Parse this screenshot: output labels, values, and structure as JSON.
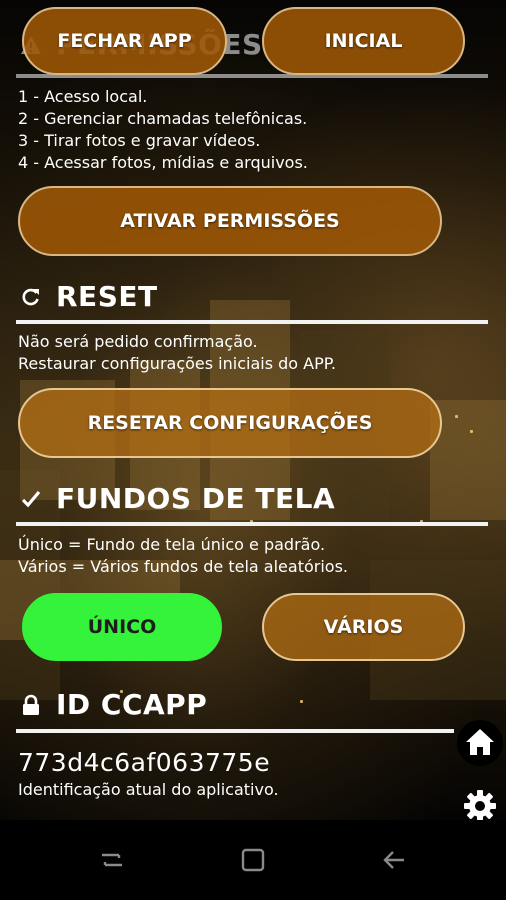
{
  "top_buttons": {
    "close_label": "FECHAR APP",
    "home_label": "INICIAL"
  },
  "permissions": {
    "title": "PERMISSÕES",
    "items": [
      "1 - Acesso local.",
      "2 - Gerenciar chamadas telefônicas.",
      "3 - Tirar fotos e gravar vídeos.",
      "4 - Acessar fotos, mídias e arquivos."
    ],
    "button_label": "ATIVAR PERMISSÕES"
  },
  "reset": {
    "title": "RESET",
    "lines": [
      "Não será pedido confirmação.",
      "Restaurar configurações iniciais do APP."
    ],
    "button_label": "RESETAR CONFIGURAÇÕES"
  },
  "wallpapers": {
    "title": "FUNDOS DE TELA",
    "lines": [
      "Único = Fundo de tela único e padrão.",
      "Vários = Vários fundos de tela aleatórios."
    ],
    "unique_label": "ÚNICO",
    "multiple_label": "VÁRIOS",
    "selected": "ÚNICO"
  },
  "app_id": {
    "title": "ID CCAPP",
    "value": "773d4c6af063775e",
    "caption": "Identificação atual do aplicativo."
  },
  "colors": {
    "button_fill": "#9e5806",
    "button_border": "#d9b785",
    "selected_green": "#35f23a",
    "rule": "#f2f2f2"
  },
  "icons": [
    "warning-icon",
    "refresh-icon",
    "check-icon",
    "lock-icon",
    "home-icon",
    "gear-icon",
    "recent-apps-icon",
    "nav-home-icon",
    "back-icon"
  ]
}
